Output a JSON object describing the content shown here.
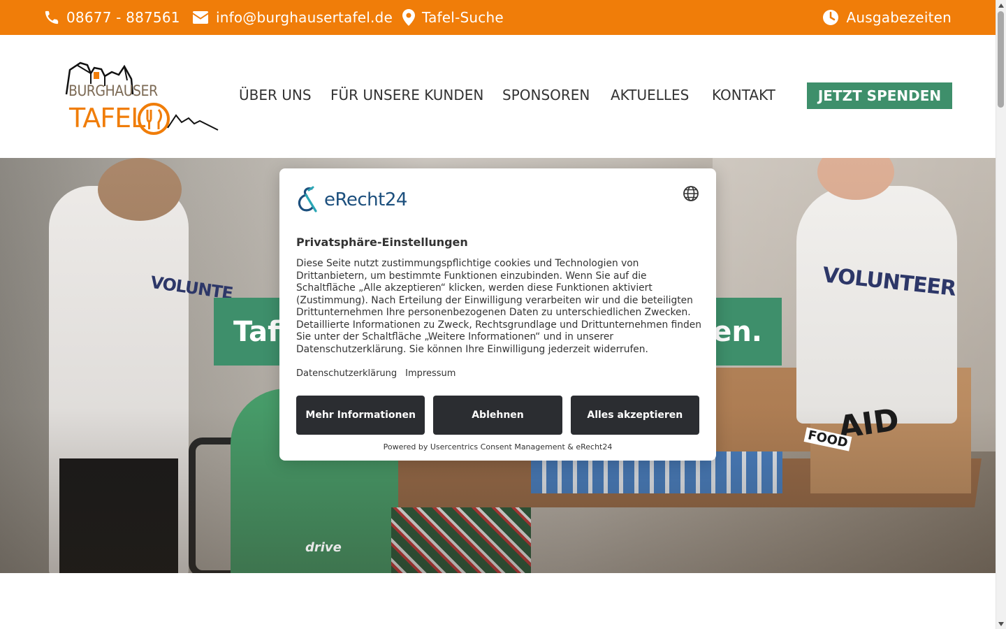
{
  "topbar": {
    "phone": "08677 - 887561",
    "email": "info@burghausertafel.de",
    "search": "Tafel-Suche",
    "hours": "Ausgabezeiten",
    "background_color": "#f07d09"
  },
  "logo": {
    "line1": "BURGHAUSER",
    "line2": "TAFEL"
  },
  "nav": {
    "items": [
      "ÜBER UNS",
      "FÜR UNSERE KUNDEN",
      "SPONSOREN",
      "AKTUELLES",
      "KONTAKT"
    ],
    "cta": "JETZT SPENDEN",
    "cta_color": "#3e8f6b"
  },
  "hero": {
    "banner_left": "Taf",
    "banner_right": "ten.",
    "shirt_text_1": "VOLUNTE",
    "shirt_text_2": "VOLUNTEER",
    "box_text_1": "AID",
    "box_text_2": "FOOD",
    "wheelchair_text": "drive"
  },
  "consent": {
    "brand": "eRecht24",
    "title": "Privatsphäre-Einstellungen",
    "description": "Diese Seite nutzt zustimmungspflichtige cookies und Technologien von Drittanbietern, um bestimmte Funktionen einzubinden. Wenn Sie auf die Schaltfläche „Alle akzeptieren“ klicken, werden diese Funktionen aktiviert (Zustimmung). Nach Erteilung der Einwilligung verarbeiten wir und die beteiligten Drittunternehmen Ihre personenbezogenen Daten zu unterschiedlichen Zwecken. Detaillierte Informationen zu Zweck, Rechtsgrundlage und Drittunternehmen finden Sie unter der Schaltfläche „Weitere Informationen“ und in unserer Datenschutzerklärung. Sie können Ihre Einwilligung jederzeit widerrufen.",
    "link_privacy": "Datenschutzerklärung",
    "link_imprint": "Impressum",
    "btn_more": "Mehr Informationen",
    "btn_decline": "Ablehnen",
    "btn_accept": "Alles akzeptieren",
    "powered_by": "Powered by Usercentrics Consent Management & eRecht24"
  }
}
